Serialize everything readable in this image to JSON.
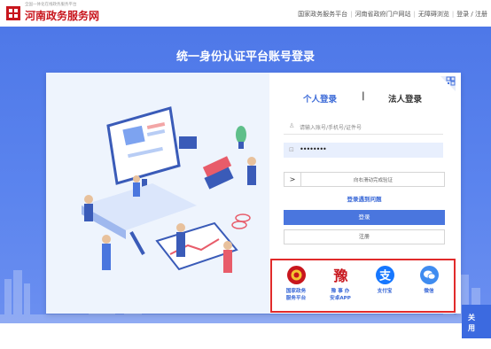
{
  "header": {
    "logo_subtitle": "全国一体化在线政务服务平台",
    "logo_title": "河南政务服务网",
    "nav": [
      "国家政务服务平台",
      "河南省政府门户网站",
      "无障碍浏览",
      "登录 / 注册"
    ]
  },
  "hero": {
    "title": "统一身份认证平台账号登录"
  },
  "login": {
    "tab_personal": "个人登录",
    "tab_separator": "|",
    "tab_corporate": "法人登录",
    "account_placeholder": "请输入账号/手机号/证件号",
    "password_value": "••••••••",
    "slider_handle": ">",
    "slider_text": "向右滑动完成验证",
    "help_link": "登录遇到问题",
    "login_button": "登录",
    "register_button": "注册"
  },
  "third_party": [
    {
      "line1": "国家政务",
      "line2": "服务平台",
      "icon": "national-emblem-icon",
      "color": "#c8161d"
    },
    {
      "line1": "豫 事 办",
      "line2": "安卓APP",
      "icon": "yushiban-icon",
      "color": "#c8161d"
    },
    {
      "line1": "支付宝",
      "line2": "",
      "icon": "alipay-icon",
      "color": "#1677ff"
    },
    {
      "line1": "微信",
      "line2": "",
      "icon": "wechat-icon",
      "color": "#3f8cf0"
    }
  ],
  "popup": {
    "line1": "关",
    "line2": "用"
  },
  "colors": {
    "accent": "#4a76de",
    "brand": "#c8161d",
    "highlight_border": "#e12b2b"
  }
}
